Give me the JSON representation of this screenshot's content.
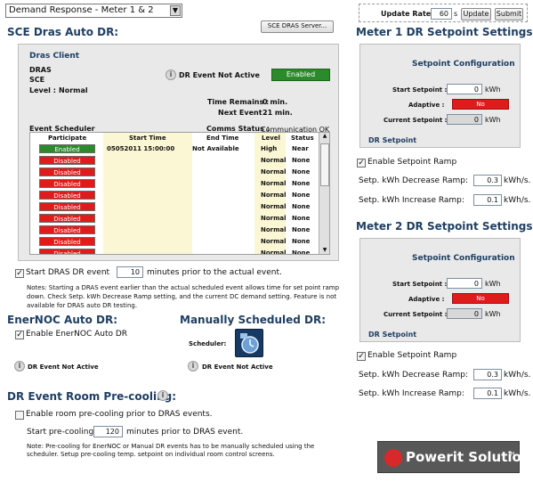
{
  "top": {
    "mode_select": "Demand Response - Meter 1 & 2",
    "update_rate_label": "Update Rate",
    "update_rate_value": "60",
    "update_rate_unit": "s",
    "update_button": "Update",
    "submit_button": "Submit",
    "sce_server_button": "SCE DRAS Server..."
  },
  "sce": {
    "title": "SCE Dras Auto DR:",
    "client_title": "Dras Client",
    "dras_label": "DRAS",
    "sce_label": "SCE",
    "level_label": "Level :",
    "level_value": "Normal",
    "dr_event_status": "DR Event Not Active",
    "enabled_badge": "Enabled",
    "time_remains_label": "Time Remains :",
    "time_remains_value": "0 min.",
    "next_event_label": "Next Event :",
    "next_event_value": "21 min.",
    "event_scheduler_label": "Event Scheduler",
    "comms_status_label": "Comms Status :",
    "comms_status_value": "Communication OK",
    "columns": [
      "Participate",
      "Start Time",
      "End Time",
      "Level",
      "Status"
    ],
    "rows": [
      {
        "participate": "Enabled",
        "start": "05052011 15:00:00",
        "end": "Not Available",
        "level": "High",
        "status": "Near"
      },
      {
        "participate": "Disabled",
        "start": "",
        "end": "",
        "level": "Normal",
        "status": "None"
      },
      {
        "participate": "Disabled",
        "start": "",
        "end": "",
        "level": "Normal",
        "status": "None"
      },
      {
        "participate": "Disabled",
        "start": "",
        "end": "",
        "level": "Normal",
        "status": "None"
      },
      {
        "participate": "Disabled",
        "start": "",
        "end": "",
        "level": "Normal",
        "status": "None"
      },
      {
        "participate": "Disabled",
        "start": "",
        "end": "",
        "level": "Normal",
        "status": "None"
      },
      {
        "participate": "Disabled",
        "start": "",
        "end": "",
        "level": "Normal",
        "status": "None"
      },
      {
        "participate": "Disabled",
        "start": "",
        "end": "",
        "level": "Normal",
        "status": "None"
      },
      {
        "participate": "Disabled",
        "start": "",
        "end": "",
        "level": "Normal",
        "status": "None"
      },
      {
        "participate": "Disabled",
        "start": "",
        "end": "",
        "level": "Normal",
        "status": "None"
      }
    ],
    "start_event_label_1": "Start DRAS DR event",
    "start_event_minutes": "10",
    "start_event_label_2": "minutes prior to the actual event.",
    "note": "Notes: Starting a DRAS event earlier than the actual scheduled event allows time for set point ramp down. Check Setp. kWh Decrease Ramp setting, and the current DC demand setting. Feature is not available for DRAS auto DR testing."
  },
  "enernoc": {
    "title": "EnerNOC Auto DR:",
    "enable_label": "Enable EnerNOC Auto DR",
    "status": "DR Event Not Active"
  },
  "manual": {
    "title": "Manually Scheduled DR:",
    "scheduler_label": "Scheduler:",
    "status": "DR Event Not Active"
  },
  "precool": {
    "title": "DR Event Room Pre-cooling:",
    "enable_label": "Enable room pre-cooling prior to DRAS events.",
    "start_label_1": "Start pre-cooling",
    "start_minutes": "120",
    "start_label_2": "minutes prior to DRAS event.",
    "note": "Note: Pre-cooling for EnerNOC or Manual DR events has to be manually scheduled using the scheduler. Setup pre-cooling temp. setpoint on individual room control screens."
  },
  "meter1": {
    "title": "Meter 1 DR Setpoint Settings:",
    "config_title": "Setpoint Configuration",
    "start_setpoint_label": "Start Setpoint :",
    "start_setpoint_value": "0",
    "start_setpoint_unit": "kWh",
    "adaptive_label": "Adaptive :",
    "adaptive_value": "No",
    "current_setpoint_label": "Current Setpoint :",
    "current_setpoint_value": "0",
    "current_setpoint_unit": "kWh",
    "panel_footer": "DR Setpoint",
    "ramp_label": "Enable Setpoint Ramp",
    "decrease_label": "Setp. kWh Decrease Ramp:",
    "decrease_value": "0.3",
    "decrease_unit": "kWh/s.",
    "increase_label": "Setp. kWh Increase Ramp:",
    "increase_value": "0.1",
    "increase_unit": "kWh/s."
  },
  "meter2": {
    "title": "Meter 2 DR Setpoint Settings:",
    "config_title": "Setpoint Configuration",
    "start_setpoint_label": "Start Setpoint :",
    "start_setpoint_value": "0",
    "start_setpoint_unit": "kWh",
    "adaptive_label": "Adaptive :",
    "adaptive_value": "No",
    "current_setpoint_label": "Current Setpoint :",
    "current_setpoint_value": "0",
    "current_setpoint_unit": "kWh",
    "panel_footer": "DR Setpoint",
    "ramp_label": "Enable Setpoint Ramp",
    "decrease_label": "Setp. kWh Decrease Ramp:",
    "decrease_value": "0.3",
    "decrease_unit": "kWh/s.",
    "increase_label": "Setp. kWh Increase Ramp:",
    "increase_value": "0.1",
    "increase_unit": "kWh/s."
  },
  "brand": {
    "name": "Powerit Solutions",
    "tm": "TM"
  },
  "colors": {
    "heading": "#1f3f63",
    "enabled": "#2b8a2b",
    "disabled": "#e01b1b",
    "panel": "#e9e9e9",
    "table_highlight": "#fbf7d4"
  }
}
